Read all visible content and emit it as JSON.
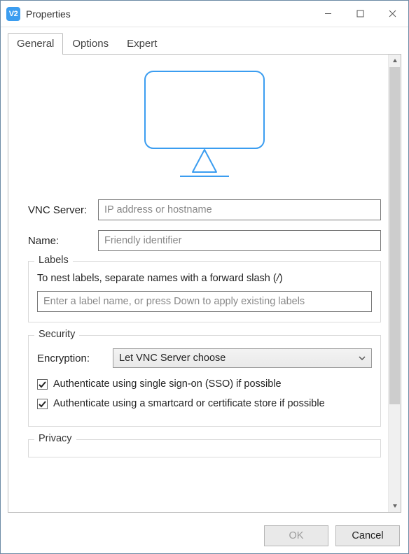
{
  "window": {
    "title": "Properties",
    "app_icon_text": "V2"
  },
  "tabs": {
    "general": "General",
    "options": "Options",
    "expert": "Expert"
  },
  "form": {
    "vnc_server_label": "VNC Server:",
    "vnc_server_placeholder": "IP address or hostname",
    "name_label": "Name:",
    "name_placeholder": "Friendly identifier"
  },
  "labels_group": {
    "legend": "Labels",
    "hint_prefix": "To nest labels, separate names with a forward slash (",
    "hint_slash": "/",
    "hint_suffix": ")",
    "input_placeholder": "Enter a label name, or press Down to apply existing labels"
  },
  "security_group": {
    "legend": "Security",
    "encryption_label": "Encryption:",
    "encryption_value": "Let VNC Server choose",
    "sso_label": "Authenticate using single sign-on (SSO) if possible",
    "smartcard_label": "Authenticate using a smartcard or certificate store if possible"
  },
  "privacy_group": {
    "legend": "Privacy"
  },
  "footer": {
    "ok": "OK",
    "cancel": "Cancel"
  }
}
